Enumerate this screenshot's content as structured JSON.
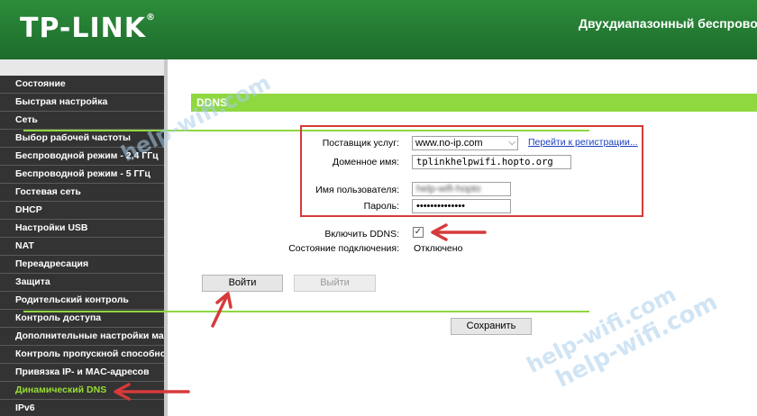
{
  "header": {
    "logo_text": "TP-LINK",
    "title": "Двухдиапазонный беспровод"
  },
  "sidebar": {
    "items": [
      {
        "label": "Состояние"
      },
      {
        "label": "Быстрая настройка"
      },
      {
        "label": "Сеть"
      },
      {
        "label": "Выбор рабочей частоты"
      },
      {
        "label": "Беспроводной режим - 2,4 ГГц"
      },
      {
        "label": "Беспроводной режим - 5 ГГц"
      },
      {
        "label": "Гостевая сеть"
      },
      {
        "label": "DHCP"
      },
      {
        "label": "Настройки USB"
      },
      {
        "label": "NAT"
      },
      {
        "label": "Переадресация"
      },
      {
        "label": "Защита"
      },
      {
        "label": "Родительский контроль"
      },
      {
        "label": "Контроль доступа"
      },
      {
        "label": "Дополнительные настройки мар"
      },
      {
        "label": "Контроль пропускной способно"
      },
      {
        "label": "Привязка IP- и MAC-адресов"
      },
      {
        "label": "Динамический DNS",
        "active": true
      },
      {
        "label": "IPv6"
      }
    ]
  },
  "main": {
    "section_title": "DDNS",
    "provider_label": "Поставщик услуг:",
    "provider_value": "www.no-ip.com",
    "register_link": "Перейти к регистрации...",
    "domain_label": "Доменное имя:",
    "domain_value": "tplinkhelpwifi.hopto.org",
    "username_label": "Имя пользователя:",
    "username_value": "help-wifi-hopto",
    "password_label": "Пароль:",
    "password_value": "••••••••••••••",
    "enable_label": "Включить DDNS:",
    "enable_checked": true,
    "status_label": "Состояние подключения:",
    "status_value": "Отключено",
    "login_button": "Войти",
    "logout_button": "Выйти",
    "save_button": "Сохранить"
  },
  "watermark": "help-wifi.com",
  "colors": {
    "header_green": "#1f7a32",
    "accent_green": "#8fd83f",
    "active_menu": "#99dd33",
    "annotation_red": "#d63a3a"
  }
}
